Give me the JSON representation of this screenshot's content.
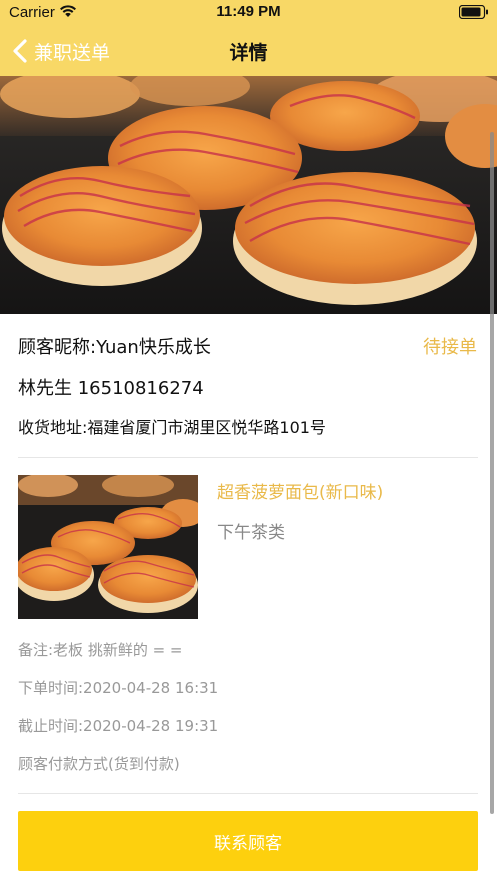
{
  "status_bar": {
    "carrier": "Carrier",
    "time": "11:49 PM"
  },
  "navbar": {
    "back_label": "兼职送单",
    "title": "详情",
    "background_color": "#f8d866"
  },
  "order": {
    "customer_nickname": "顾客昵称:Yuan快乐成长",
    "status": "待接单",
    "contact": "林先生 16510816274",
    "address": "收货地址:福建省厦门市湖里区悦华路101号"
  },
  "product": {
    "name": "超香菠萝面包(新口味)",
    "category": "下午茶类"
  },
  "details": {
    "note": "备注:老板 挑新鲜的 = =",
    "order_time": "下单时间:2020-04-28 16:31",
    "deadline": "截止时间:2020-04-28 19:31",
    "payment": "顾客付款方式(货到付款)"
  },
  "actions": {
    "contact_button": "联系顾客",
    "button_color": "#fdd00e"
  },
  "colors": {
    "accent": "#e9b949",
    "secondary_text": "#999999"
  },
  "icons": {
    "back": "chevron-left-icon",
    "wifi": "wifi-icon",
    "battery": "battery-icon"
  }
}
